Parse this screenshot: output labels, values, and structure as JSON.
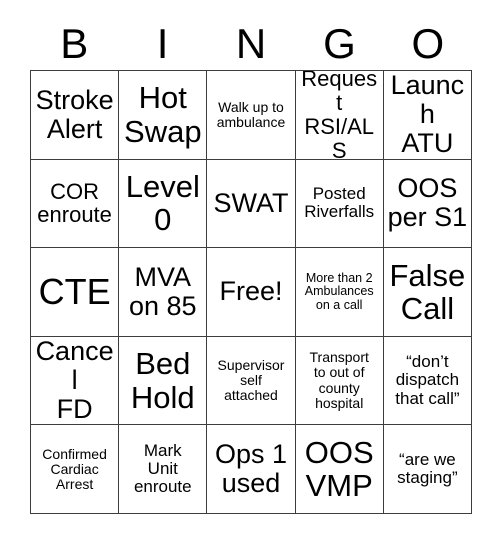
{
  "card": {
    "title": "BINGO",
    "header_letters": [
      "B",
      "I",
      "N",
      "G",
      "O"
    ],
    "colors": {
      "background": "#ffffff",
      "text": "#000000",
      "grid_line": "#3d3d3d"
    },
    "grid_size": "5x5",
    "cells": [
      {
        "text": "Stroke\nAlert",
        "size": "lg",
        "row": 1,
        "col": 1
      },
      {
        "text": "Hot\nSwap",
        "size": "xl",
        "row": 1,
        "col": 2
      },
      {
        "text": "Walk up to\nambulance",
        "size": "xs",
        "row": 1,
        "col": 3
      },
      {
        "text": "Request\nRSI/ALS",
        "size": "md",
        "row": 1,
        "col": 4
      },
      {
        "text": "Launch\nATU",
        "size": "lg",
        "row": 1,
        "col": 5
      },
      {
        "text": "COR\nenroute",
        "size": "md",
        "row": 2,
        "col": 1
      },
      {
        "text": "Level\n0",
        "size": "xl",
        "row": 2,
        "col": 2
      },
      {
        "text": "SWAT",
        "size": "lg",
        "row": 2,
        "col": 3
      },
      {
        "text": "Posted\nRiverfalls",
        "size": "sm",
        "row": 2,
        "col": 4
      },
      {
        "text": "OOS\nper S1",
        "size": "lg",
        "row": 2,
        "col": 5
      },
      {
        "text": "CTE",
        "size": "xxl",
        "row": 3,
        "col": 1
      },
      {
        "text": "MVA\non 85",
        "size": "lg",
        "row": 3,
        "col": 2
      },
      {
        "text": "Free!",
        "size": "lg",
        "row": 3,
        "col": 3,
        "free_space": true
      },
      {
        "text": "More than 2\nAmbulances\non a call",
        "size": "xxs",
        "row": 3,
        "col": 4
      },
      {
        "text": "False\nCall",
        "size": "xl",
        "row": 3,
        "col": 5
      },
      {
        "text": "Cancel\nFD",
        "size": "lg",
        "row": 4,
        "col": 1
      },
      {
        "text": "Bed\nHold",
        "size": "xl",
        "row": 4,
        "col": 2
      },
      {
        "text": "Supervisor\nself\nattached",
        "size": "xs",
        "row": 4,
        "col": 3
      },
      {
        "text": "Transport\nto out of\ncounty\nhospital",
        "size": "xs",
        "row": 4,
        "col": 4
      },
      {
        "text": "“don’t\ndispatch\nthat call”",
        "size": "sm",
        "row": 4,
        "col": 5
      },
      {
        "text": "Confirmed\nCardiac\nArrest",
        "size": "xs",
        "row": 5,
        "col": 1
      },
      {
        "text": "Mark\nUnit\nenroute",
        "size": "sm",
        "row": 5,
        "col": 2
      },
      {
        "text": "Ops 1\nused",
        "size": "lg",
        "row": 5,
        "col": 3
      },
      {
        "text": "OOS\nVMP",
        "size": "xl",
        "row": 5,
        "col": 4
      },
      {
        "text": "“are we\nstaging”",
        "size": "sm",
        "row": 5,
        "col": 5
      }
    ]
  }
}
